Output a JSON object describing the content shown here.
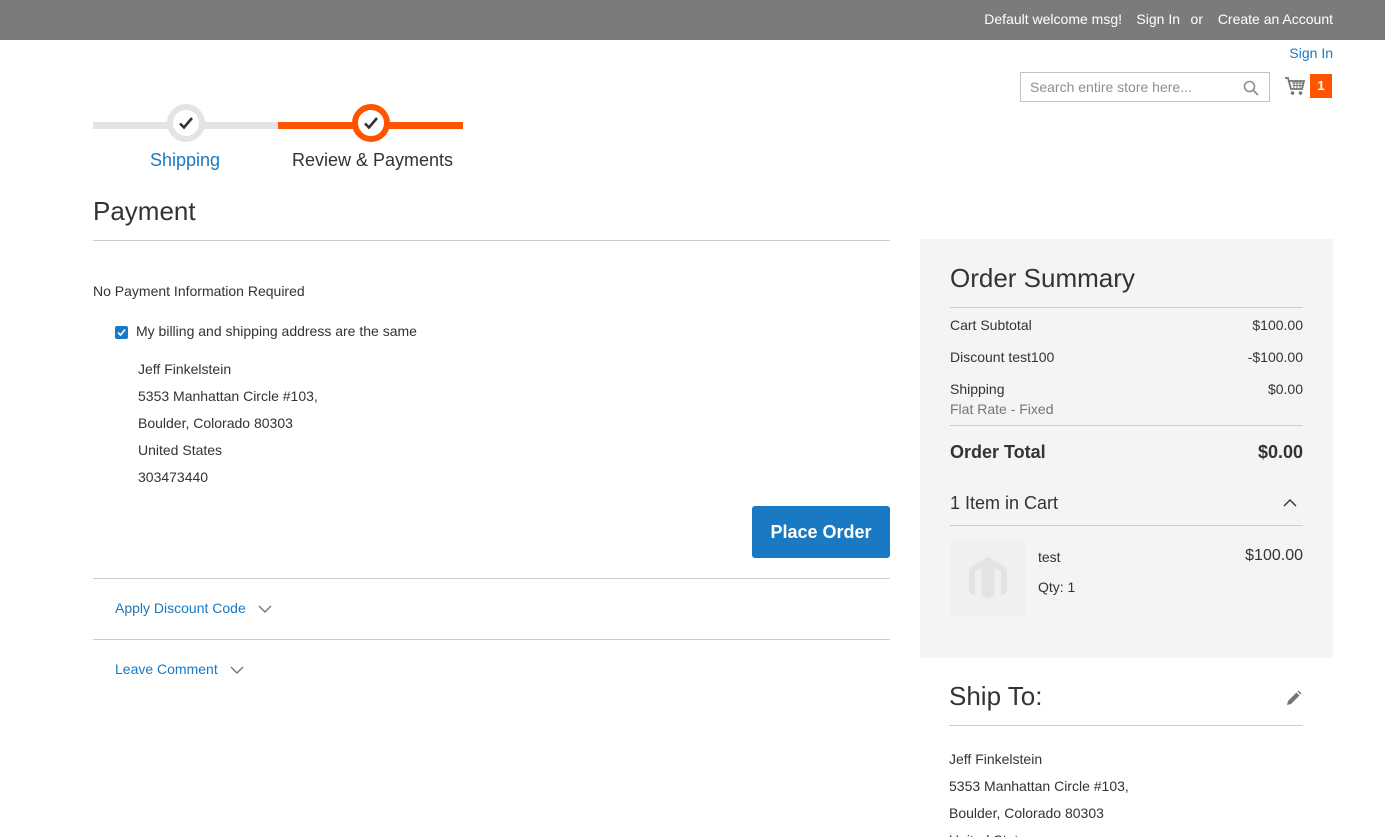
{
  "topbar": {
    "welcome": "Default welcome msg!",
    "sign_in": "Sign In",
    "or": "or",
    "create_account": "Create an Account"
  },
  "header": {
    "sign_in": "Sign In",
    "search_placeholder": "Search entire store here...",
    "search_icon": "magnifier-icon",
    "cart_icon": "shopping-cart-icon",
    "cart_count": "1"
  },
  "progress": {
    "steps": [
      {
        "label": "Shipping",
        "state": "complete"
      },
      {
        "label": "Review & Payments",
        "state": "active"
      }
    ],
    "accent": "#ff5501"
  },
  "payment": {
    "title": "Payment",
    "no_payment": "No Payment Information Required",
    "billing_same_label": "My billing and shipping address are the same",
    "billing_same_checked": true,
    "address": {
      "name": "Jeff Finkelstein",
      "street": "5353 Manhattan Circle #103,",
      "city_line": "Boulder, Colorado 80303",
      "country": "United States",
      "phone": "303473440"
    },
    "place_order": "Place Order",
    "discount_toggle": "Apply Discount Code",
    "comment_toggle": "Leave Comment"
  },
  "summary": {
    "title": "Order Summary",
    "subtotal_label": "Cart Subtotal",
    "subtotal_value": "$100.00",
    "discount_label": "Discount test100",
    "discount_value": "-$100.00",
    "shipping_label": "Shipping",
    "shipping_method": "Flat Rate - Fixed",
    "shipping_value": "$0.00",
    "total_label": "Order Total",
    "total_value": "$0.00",
    "items_toggle": "1 Item in Cart",
    "item": {
      "name": "test",
      "price": "$100.00",
      "qty": "Qty: 1"
    }
  },
  "ship_to": {
    "title": "Ship To:",
    "edit_icon": "pencil-icon",
    "name": "Jeff Finkelstein",
    "street": "5353 Manhattan Circle #103,",
    "city_line": "Boulder, Colorado 80303",
    "country": "United States"
  },
  "colors": {
    "link": "#1979c3",
    "primary_button": "#1979c3",
    "accent": "#ff5501",
    "topbar": "#7b7c7a",
    "summary_bg": "#f4f4f4"
  }
}
